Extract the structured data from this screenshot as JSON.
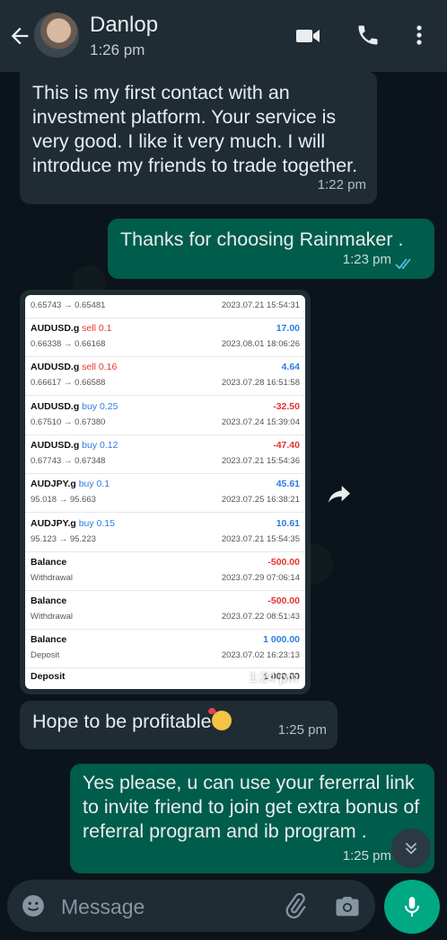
{
  "header": {
    "contact_name": "Danlop",
    "status": "1:26 pm"
  },
  "messages": [
    {
      "direction": "incoming",
      "text": "This is my first contact with an investment platform. Your service is very good. I like it very much. I will introduce my friends to trade together.",
      "time": "1:22 pm"
    },
    {
      "direction": "outgoing",
      "text": "Thanks for choosing Rainmaker .",
      "time": "1:23 pm",
      "status": "read"
    },
    {
      "direction": "incoming",
      "type": "image",
      "time": "1:24 pm"
    },
    {
      "direction": "incoming",
      "text": "Hope to be profitable",
      "emoji": "smiling-face-with-hearts",
      "time": "1:25 pm"
    },
    {
      "direction": "outgoing",
      "text": "Yes please, u can use your fererral link to invite friend to join get extra bonus of referral program and ib program .",
      "time": "1:25 pm"
    }
  ],
  "screenshot": {
    "top_row": {
      "prices": "0.65743 → 0.65481",
      "date": "2023.07.21 15:54:31"
    },
    "rows": [
      {
        "symbol": "AUDUSD.g",
        "side": "sell 0.1",
        "side_type": "sell",
        "prices": "0.66338 → 0.66168",
        "profit": "17.00",
        "profit_sign": "pos",
        "date": "2023.08.01 18:06:26"
      },
      {
        "symbol": "AUDUSD.g",
        "side": "sell 0.16",
        "side_type": "sell",
        "prices": "0.66617 → 0.66588",
        "profit": "4.64",
        "profit_sign": "pos",
        "date": "2023.07.28 16:51:58"
      },
      {
        "symbol": "AUDUSD.g",
        "side": "buy 0.25",
        "side_type": "buy",
        "prices": "0.67510 → 0.67380",
        "profit": "-32.50",
        "profit_sign": "neg",
        "date": "2023.07.24 15:39:04"
      },
      {
        "symbol": "AUDUSD.g",
        "side": "buy 0.12",
        "side_type": "buy",
        "prices": "0.67743 → 0.67348",
        "profit": "-47.40",
        "profit_sign": "neg",
        "date": "2023.07.21 15:54:36"
      },
      {
        "symbol": "AUDJPY.g",
        "side": "buy 0.1",
        "side_type": "buy",
        "prices": "95.018 → 95.663",
        "profit": "45.61",
        "profit_sign": "pos",
        "date": "2023.07.25 16:38:21"
      },
      {
        "symbol": "AUDJPY.g",
        "side": "buy 0.15",
        "side_type": "buy",
        "prices": "95.123 → 95.223",
        "profit": "10.61",
        "profit_sign": "pos",
        "date": "2023.07.21 15:54:35"
      },
      {
        "symbol": "Balance",
        "side": "",
        "side_type": "",
        "prices": "Withdrawal",
        "profit": "-500.00",
        "profit_sign": "neg",
        "date": "2023.07.29 07:06:14"
      },
      {
        "symbol": "Balance",
        "side": "",
        "side_type": "",
        "prices": "Withdrawal",
        "profit": "-500.00",
        "profit_sign": "neg",
        "date": "2023.07.22 08:51:43"
      },
      {
        "symbol": "Balance",
        "side": "",
        "side_type": "",
        "prices": "Deposit",
        "profit": "1 000.00",
        "profit_sign": "pos",
        "date": "2023.07.02 16:23:13"
      }
    ],
    "bottom_row": {
      "label": "Deposit",
      "value": "1 000.00"
    }
  },
  "composer": {
    "placeholder": "Message"
  },
  "colors": {
    "incoming": "#1f2c34",
    "outgoing": "#005c4b",
    "accent": "#00a884",
    "read_ticks": "#53bdeb"
  }
}
